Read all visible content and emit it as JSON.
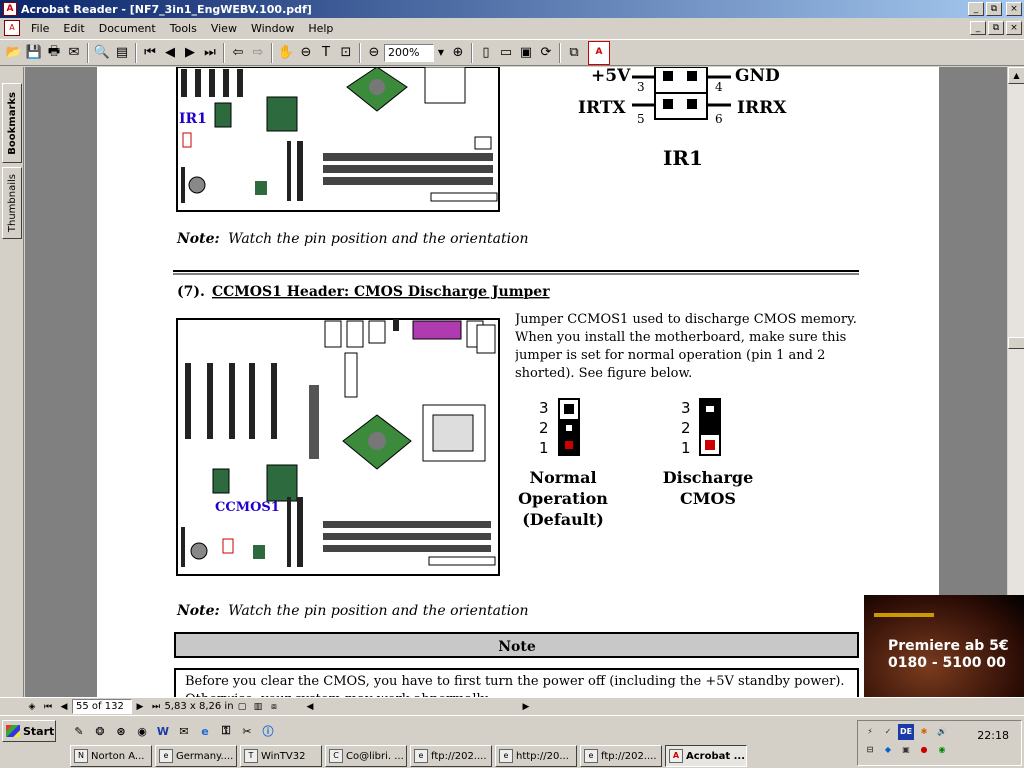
{
  "window": {
    "title": "Acrobat Reader - [NF7_3in1_EngWEBV.100.pdf]",
    "controls": {
      "minimize": "_",
      "maximize": "□",
      "close": "×",
      "restore": "⧉"
    }
  },
  "menu": [
    "File",
    "Edit",
    "Document",
    "Tools",
    "View",
    "Window",
    "Help"
  ],
  "toolbar": {
    "zoom": "200%"
  },
  "nav_tabs": {
    "bookmarks": "Bookmarks",
    "thumbnails": "Thumbnails"
  },
  "document": {
    "ir_pins": {
      "vcc": "+5V",
      "gnd": "GND",
      "irtx": "IRTX",
      "irrx": "IRRX",
      "p3": "3",
      "p4": "4",
      "p5": "5",
      "p6": "6",
      "title": "IR1"
    },
    "board_label_ir": "IR1",
    "note1_bold": "Note:",
    "note1_text": "Watch the pin position and the orientation",
    "section_number": "(7).",
    "section_title": "CCMOS1 Header: CMOS Discharge Jumper",
    "body_text": "Jumper CCMOS1 used to discharge CMOS memory. When you install the motherboard, make sure this jumper is set for normal operation (pin 1 and 2 shorted). See figure below.",
    "jumper_normal": {
      "p3": "3",
      "p2": "2",
      "p1": "1",
      "label1": "Normal",
      "label2": "Operation",
      "label3": "(Default)"
    },
    "jumper_discharge": {
      "p3": "3",
      "p2": "2",
      "p1": "1",
      "label1": "Discharge",
      "label2": "CMOS"
    },
    "board_label_ccmos": "CCMOS1",
    "note2_bold": "Note:",
    "note2_text": "Watch the pin position and the orientation",
    "note_box_title": "Note",
    "note_box_text": "Before you clear the CMOS, you have to first turn the power off (including the +5V standby power). Otherwise, your system may work abnormally."
  },
  "status": {
    "page": "55 of 132",
    "size": "5,83 x 8,26 in"
  },
  "ad": {
    "line1": "Premiere ab 5€",
    "line2": "0180 - 5100 00"
  },
  "taskbar": {
    "start": "Start",
    "tasks": [
      "Norton A...",
      "Germany....",
      "WinTV32",
      "Co@libri. ...",
      "ftp://202....",
      "http://20...",
      "ftp://202....",
      "Acrobat ..."
    ],
    "tray_lang": "DE",
    "clock": "22:18"
  }
}
